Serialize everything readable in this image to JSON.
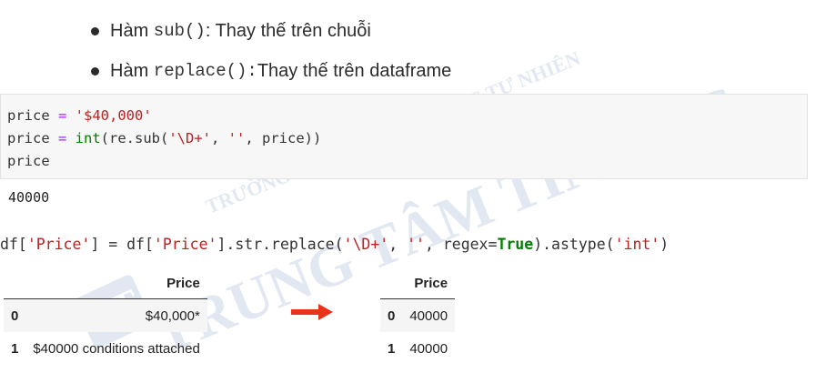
{
  "bullets": [
    {
      "prefix": "Hàm ",
      "code": "sub()",
      "suffix": ": Thay thế trên chuỗi"
    },
    {
      "prefix": "Hàm ",
      "code": "replace(): ",
      "suffix": " Thay thế trên dataframe"
    }
  ],
  "code_cell": {
    "line1": {
      "var": "price",
      "op": " = ",
      "str": "'$40,000'"
    },
    "line2": {
      "var": "price",
      "op": " = ",
      "fn": "int",
      "rest1": "(re.sub(",
      "str1": "'\\D+'",
      "comma1": ", ",
      "str2": "''",
      "rest2": ", price))"
    },
    "line3": "price"
  },
  "output": "40000",
  "code_line2": {
    "p1": "df[",
    "s1": "'Price'",
    "p2": "] = df[",
    "s2": "'Price'",
    "p3": "].str.replace(",
    "s3": "'\\D+'",
    "p4": ", ",
    "s4": "''",
    "p5": ", regex=",
    "kw": "True",
    "p6": ").astype(",
    "s5": "'int'",
    "p7": ")"
  },
  "table_before": {
    "header": "Price",
    "rows": [
      {
        "index": "0",
        "value": "$40,000*"
      },
      {
        "index": "1",
        "value": "$40000 conditions attached"
      }
    ]
  },
  "table_after": {
    "header": "Price",
    "rows": [
      {
        "index": "0",
        "value": "40000"
      },
      {
        "index": "1",
        "value": "40000"
      }
    ]
  },
  "watermark": {
    "line1": "TRƯỜNG ĐẠI HỌC KHOA HỌC TỰ NHIÊN",
    "line2": "TRUNG TÂM TIN HỌC",
    "logo": "TT"
  },
  "colors": {
    "arrow": "#e8321c",
    "string": "#ba2121",
    "keyword": "#008000",
    "operator": "#aa22ff"
  }
}
